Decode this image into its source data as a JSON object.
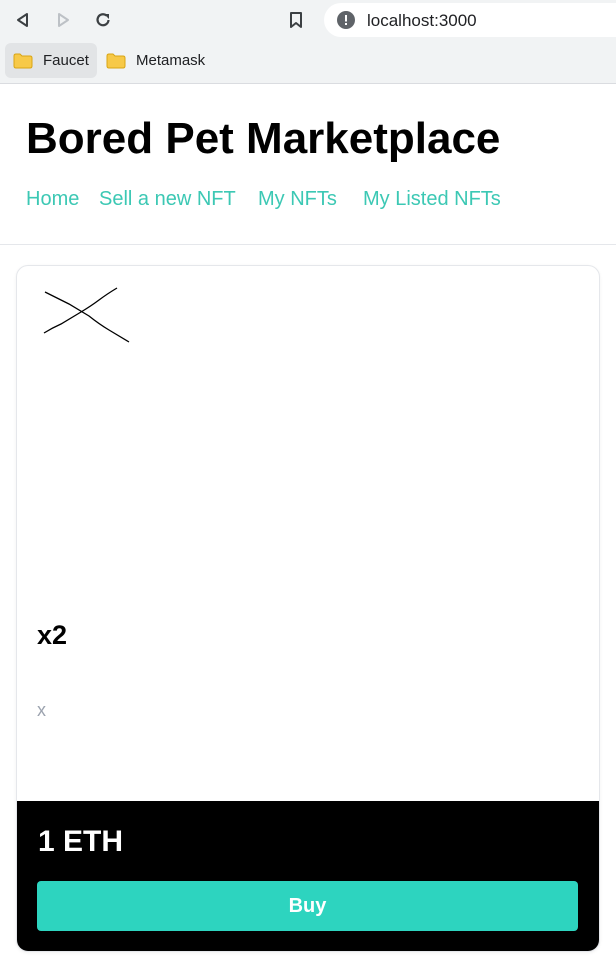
{
  "browser": {
    "url": "localhost:3000",
    "bookmarks": [
      {
        "label": "Faucet"
      },
      {
        "label": "Metamask"
      }
    ]
  },
  "site": {
    "title": "Bored Pet Marketplace",
    "nav": [
      {
        "label": "Home"
      },
      {
        "label": "Sell a new NFT"
      },
      {
        "label": "My NFTs"
      },
      {
        "label": "My Listed NFTs"
      }
    ]
  },
  "nft": {
    "image_icon": "hand-drawn-x-sketch",
    "name": "x2",
    "description": "x",
    "price": "1 ETH",
    "buy_label": "Buy"
  },
  "colors": {
    "accent": "#2dd4bf",
    "nav_link": "#3cc8b4",
    "footer_bg": "#000000"
  }
}
